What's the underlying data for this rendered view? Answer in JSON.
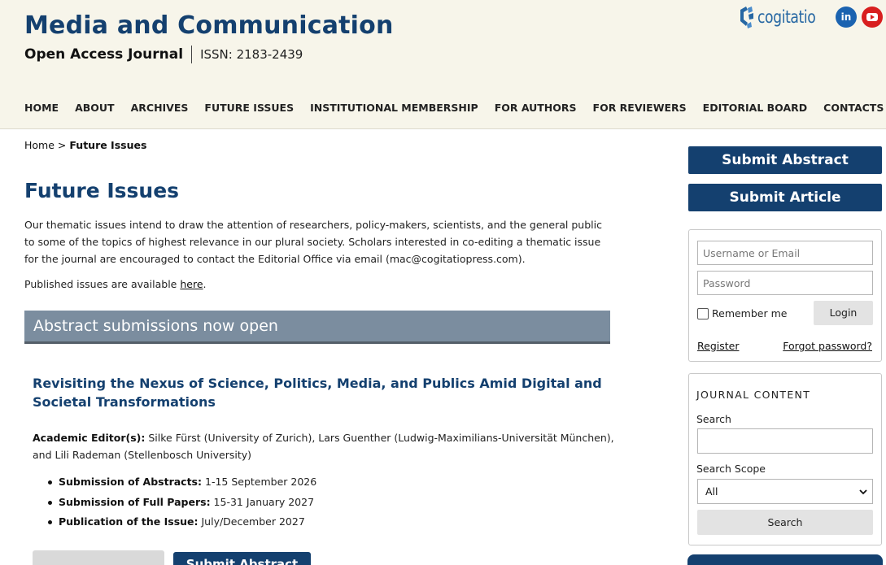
{
  "header": {
    "title": "Media and Communication",
    "subtitle": "Open Access Journal",
    "issn": "ISSN: 2183-2439",
    "brand": "cogitatio",
    "social": [
      {
        "name": "linkedin-icon",
        "label": "in"
      },
      {
        "name": "youtube-icon",
        "label": ""
      }
    ],
    "colors": {
      "primary": "#14406f",
      "header_bg": "#f7f5ea",
      "linkedin": "#1b63b0",
      "youtube": "#d81f1f"
    }
  },
  "nav": {
    "items": [
      {
        "label": "HOME"
      },
      {
        "label": "ABOUT"
      },
      {
        "label": "ARCHIVES"
      },
      {
        "label": "FUTURE ISSUES"
      },
      {
        "label": "INSTITUTIONAL MEMBERSHIP"
      },
      {
        "label": "FOR AUTHORS"
      },
      {
        "label": "FOR REVIEWERS"
      },
      {
        "label": "EDITORIAL BOARD"
      },
      {
        "label": "CONTACTS"
      }
    ]
  },
  "breadcrumb": {
    "home": "Home",
    "separator": ">",
    "current": "Future Issues"
  },
  "main": {
    "title": "Future Issues",
    "intro": "Our thematic issues intend to draw the attention of researchers, policy-makers, scientists, and the general public to some of the topics of highest relevance in our plural society. Scholars interested in co-editing a thematic issue for the journal are encouraged to contact the Editorial Office via email (mac@cogitatiopress.com).",
    "published_prefix": "Published issues are available ",
    "published_link": "here",
    "published_suffix": ".",
    "banner": "Abstract submissions now open",
    "issue": {
      "title": "Revisiting the Nexus of Science, Politics, Media, and Publics Amid Digital and Societal Transformations",
      "editors_label": "Academic Editor(s):",
      "editors": " Silke Fürst (University of Zurich), Lars Guenther (Ludwig-Maximilians-Universität München), and Lili Rademan (Stellenbosch University)",
      "dates": [
        {
          "label": "Submission of Abstracts:",
          "value": " 1-15 September 2026"
        },
        {
          "label": "Submission of Full Papers:",
          "value": " 15-31 January 2027"
        },
        {
          "label": "Publication of the Issue:",
          "value": " July/December 2027"
        }
      ],
      "submit_abstract_partial": "Submit Abstract"
    }
  },
  "sidebar": {
    "submit_abstract": "Submit Abstract",
    "submit_article": "Submit Article",
    "login": {
      "username_placeholder": "Username or Email",
      "password_placeholder": "Password",
      "remember": "Remember me",
      "login_button": "Login",
      "register": "Register",
      "forgot": "Forgot password?"
    },
    "journal_content": {
      "heading": "JOURNAL CONTENT",
      "search_label": "Search",
      "scope_label": "Search Scope",
      "scope_value": "All",
      "search_button": "Search"
    }
  }
}
